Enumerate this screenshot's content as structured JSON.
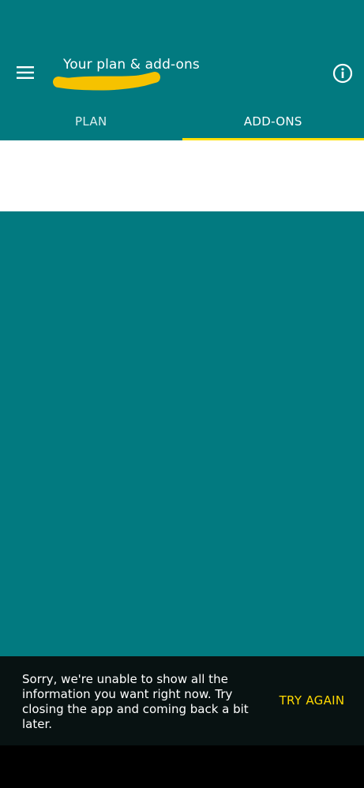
{
  "app_bar": {
    "title": "Your plan & add-ons",
    "menu_icon": "menu-icon",
    "info_icon": "info-icon"
  },
  "tabs": [
    {
      "label": "PLAN",
      "active": false
    },
    {
      "label": "ADD-ONS",
      "active": true
    }
  ],
  "snackbar": {
    "message": "Sorry, we're unable to show all the information you want right now. Try closing the app and coming back a bit later.",
    "action": "TRY AGAIN"
  },
  "colors": {
    "primary": "#027a80",
    "accent": "#ffe000",
    "snackbar_bg": "#081212",
    "white": "#ffffff"
  }
}
